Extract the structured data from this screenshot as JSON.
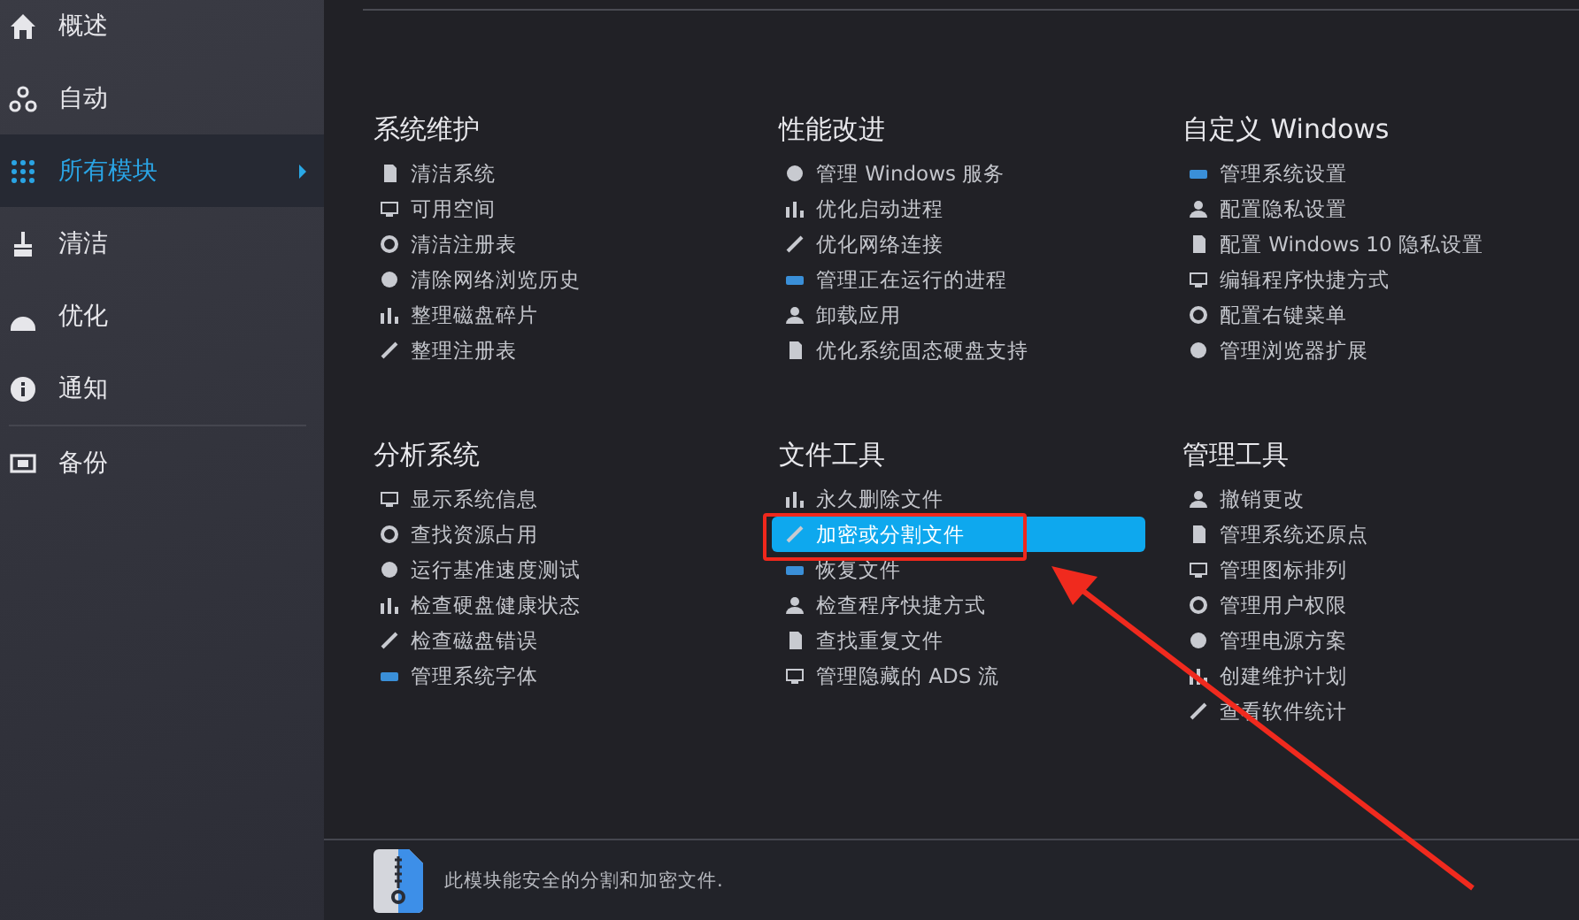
{
  "sidebar": {
    "items": [
      {
        "label": "概述",
        "selected": false
      },
      {
        "label": "自动",
        "selected": false
      },
      {
        "label": "所有模块",
        "selected": true
      },
      {
        "label": "清洁",
        "selected": false
      },
      {
        "label": "优化",
        "selected": false
      },
      {
        "label": "通知",
        "selected": false
      },
      {
        "label": "备份",
        "selected": false
      }
    ]
  },
  "sections": [
    {
      "title": "系统维护",
      "items": [
        {
          "label": "清洁系统",
          "selected": false
        },
        {
          "label": "可用空间",
          "selected": false
        },
        {
          "label": "清洁注册表",
          "selected": false
        },
        {
          "label": "清除网络浏览历史",
          "selected": false
        },
        {
          "label": "整理磁盘碎片",
          "selected": false
        },
        {
          "label": "整理注册表",
          "selected": false
        }
      ]
    },
    {
      "title": "性能改进",
      "items": [
        {
          "label": "管理 Windows 服务",
          "selected": false
        },
        {
          "label": "优化启动进程",
          "selected": false
        },
        {
          "label": "优化网络连接",
          "selected": false
        },
        {
          "label": "管理正在运行的进程",
          "selected": false
        },
        {
          "label": "卸载应用",
          "selected": false
        },
        {
          "label": "优化系统固态硬盘支持",
          "selected": false
        }
      ]
    },
    {
      "title": "自定义 Windows",
      "items": [
        {
          "label": "管理系统设置",
          "selected": false
        },
        {
          "label": "配置隐私设置",
          "selected": false
        },
        {
          "label": "配置 Windows 10 隐私设置",
          "selected": false
        },
        {
          "label": "编辑程序快捷方式",
          "selected": false
        },
        {
          "label": "配置右键菜单",
          "selected": false
        },
        {
          "label": "管理浏览器扩展",
          "selected": false
        }
      ]
    },
    {
      "title": "分析系统",
      "items": [
        {
          "label": "显示系统信息",
          "selected": false
        },
        {
          "label": "查找资源占用",
          "selected": false
        },
        {
          "label": "运行基准速度测试",
          "selected": false
        },
        {
          "label": "检查硬盘健康状态",
          "selected": false
        },
        {
          "label": "检查磁盘错误",
          "selected": false
        },
        {
          "label": "管理系统字体",
          "selected": false
        }
      ]
    },
    {
      "title": "文件工具",
      "items": [
        {
          "label": "永久删除文件",
          "selected": false
        },
        {
          "label": "加密或分割文件",
          "selected": true
        },
        {
          "label": "恢复文件",
          "selected": false
        },
        {
          "label": "检查程序快捷方式",
          "selected": false
        },
        {
          "label": "查找重复文件",
          "selected": false
        },
        {
          "label": "管理隐藏的 ADS 流",
          "selected": false
        }
      ]
    },
    {
      "title": "管理工具",
      "items": [
        {
          "label": "撤销更改",
          "selected": false
        },
        {
          "label": "管理系统还原点",
          "selected": false
        },
        {
          "label": "管理图标排列",
          "selected": false
        },
        {
          "label": "管理用户权限",
          "selected": false
        },
        {
          "label": "管理电源方案",
          "selected": false
        },
        {
          "label": "创建维护计划",
          "selected": false
        },
        {
          "label": "查看软件统计",
          "selected": false
        }
      ]
    }
  ],
  "footer": {
    "description": "此模块能安全的分割和加密文件."
  }
}
